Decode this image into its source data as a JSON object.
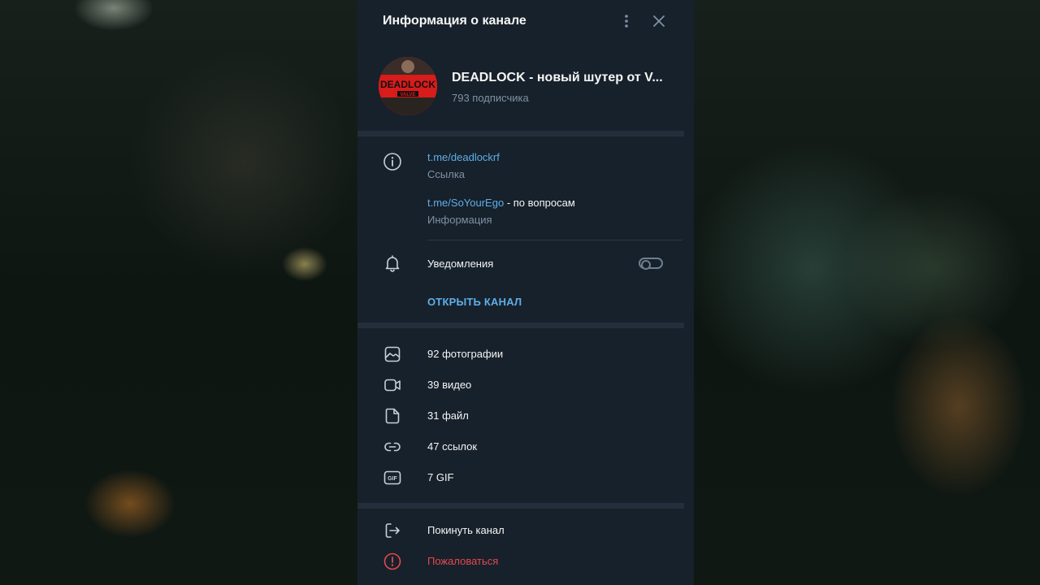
{
  "header": {
    "title": "Информация о канале",
    "menu_icon": "more-vertical-icon",
    "close_icon": "close-icon"
  },
  "channel": {
    "avatar_text": "DEADLOCK",
    "avatar_subtext": "VALVE",
    "title": "DEADLOCK - новый шутер от V...",
    "subscribers": "793 подписчика"
  },
  "info": {
    "link1": "t.me/deadlockrf",
    "link1_caption": "Ссылка",
    "link2": "t.me/SoYourEgo",
    "link2_suffix": " - по вопросам",
    "link2_caption": "Информация"
  },
  "notifications": {
    "label": "Уведомления",
    "enabled": false
  },
  "open_channel_label": "ОТКРЫТЬ КАНАЛ",
  "media": [
    {
      "icon": "photo-icon",
      "label": "92 фотографии"
    },
    {
      "icon": "video-icon",
      "label": "39 видео"
    },
    {
      "icon": "file-icon",
      "label": "31 файл"
    },
    {
      "icon": "link-icon",
      "label": "47 ссылок"
    },
    {
      "icon": "gif-icon",
      "label": "7 GIF"
    }
  ],
  "actions": {
    "leave": "Покинуть канал",
    "report": "Пожаловаться"
  },
  "colors": {
    "accent": "#5eaee9",
    "danger": "#e5484d",
    "panel": "#17212b"
  }
}
